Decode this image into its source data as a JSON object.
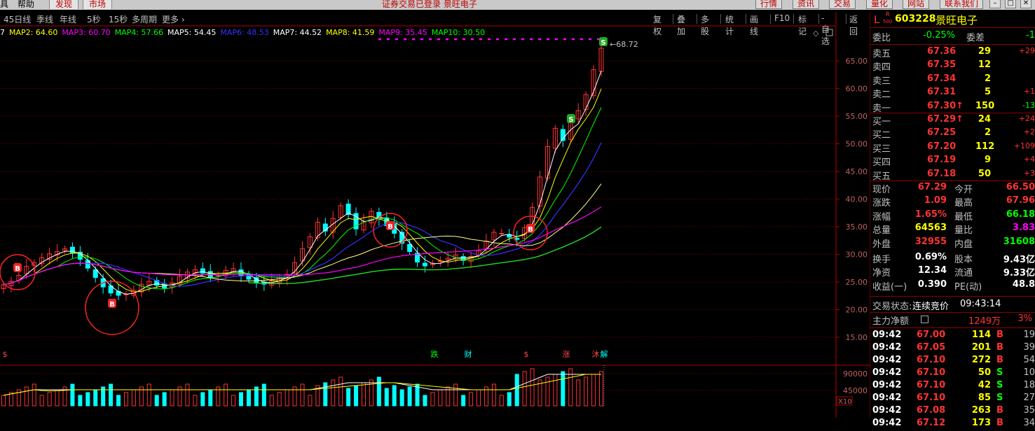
{
  "topbar": {
    "menu_items": [
      "具",
      "帮助"
    ],
    "tabs": [
      "发现",
      "市场"
    ],
    "status": "证券交易已登录  景旺电子",
    "right_buttons": [
      "行情",
      "资讯",
      "交易",
      "量化",
      "网站",
      "联系我们"
    ]
  },
  "periodbar": {
    "periods": [
      "45日线",
      "季线",
      "年线",
      "5秒",
      "15秒",
      "多周期",
      "更多 ›"
    ],
    "tools": [
      "复权",
      "叠加",
      "多股",
      "统计",
      "画线",
      "F10",
      "标记",
      "-自选",
      "返回"
    ]
  },
  "ma_legend": [
    {
      "label": "7",
      "value": "",
      "color": "#ffffff"
    },
    {
      "label": "MAP2:",
      "value": "64.60",
      "color": "#ffff00"
    },
    {
      "label": "MAP3:",
      "value": "60.70",
      "color": "#ff00ff"
    },
    {
      "label": "MAP4:",
      "value": "57.66",
      "color": "#00ff00"
    },
    {
      "label": "MAP5:",
      "value": "54.45",
      "color": "#ffffff"
    },
    {
      "label": "MAP6:",
      "value": "48.53",
      "color": "#3333ff"
    },
    {
      "label": "MAP7:",
      "value": "44.52",
      "color": "#ffffff"
    },
    {
      "label": "MAP8:",
      "value": "41.59",
      "color": "#ffff00"
    },
    {
      "label": "MAP9:",
      "value": "35.45",
      "color": "#ff00ff"
    },
    {
      "label": "MAP10:",
      "value": "30.50",
      "color": "#00ff00"
    }
  ],
  "chart_data": {
    "type": "candlestick",
    "y_ticks": [
      "65.00",
      "60.00",
      "55.00",
      "50.00",
      "45.00",
      "40.00",
      "35.00",
      "30.00",
      "25.00",
      "20.00",
      "15.00"
    ],
    "y_range": [
      15,
      68.72
    ],
    "high_label": "68.72",
    "volume_ticks": [
      "90000",
      "45000"
    ],
    "volume_unit": "X10",
    "event_markers": [
      "$",
      "跌",
      "财",
      "$",
      "涨",
      "沐",
      "解"
    ],
    "signals": [
      "B",
      "B",
      "B",
      "B",
      "S",
      "S"
    ],
    "closes": [
      24.5,
      25.1,
      26.2,
      27.8,
      28.5,
      29.4,
      30.1,
      30.5,
      31.0,
      30.2,
      29.1,
      27.5,
      25.8,
      24.1,
      23.0,
      22.6,
      22.8,
      23.5,
      24.6,
      25.1,
      24.4,
      23.9,
      24.8,
      26.0,
      26.8,
      27.2,
      26.6,
      25.9,
      26.3,
      27.1,
      27.4,
      26.2,
      25.5,
      24.8,
      24.6,
      25.2,
      25.8,
      26.4,
      28.5,
      31.0,
      33.2,
      35.8,
      34.2,
      36.5,
      38.8,
      37.2,
      34.6,
      36.0,
      37.8,
      36.4,
      35.2,
      33.8,
      32.0,
      30.5,
      28.6,
      27.9,
      28.4,
      28.8,
      29.3,
      29.9,
      28.9,
      29.6,
      30.7,
      32.4,
      34.0,
      33.8,
      33.1,
      32.7,
      34.8,
      38.5,
      44.0,
      49.5,
      52.8,
      50.6,
      54.2,
      56.0,
      58.9,
      63.4,
      67.29
    ]
  },
  "quote": {
    "code_prefix": "L",
    "code_tag_top": "R",
    "code_tag_bottom": "500",
    "code": "603228",
    "name": "景旺电子",
    "weibi_label": "委比",
    "weibi": "-0.25%",
    "weicha_label": "委差",
    "weicha": "-1",
    "asks": [
      {
        "label": "卖五",
        "price": "67.36",
        "vol": "29",
        "chg": "+29"
      },
      {
        "label": "卖四",
        "price": "67.35",
        "vol": "12",
        "chg": ""
      },
      {
        "label": "卖三",
        "price": "67.34",
        "vol": "2",
        "chg": ""
      },
      {
        "label": "卖二",
        "price": "67.31",
        "vol": "5",
        "chg": "+1"
      },
      {
        "label": "卖一",
        "price": "67.30↑",
        "vol": "150",
        "chg": "-13"
      }
    ],
    "bids": [
      {
        "label": "买一",
        "price": "67.29↑",
        "vol": "24",
        "chg": "+24"
      },
      {
        "label": "买二",
        "price": "67.25",
        "vol": "2",
        "chg": "+2"
      },
      {
        "label": "买三",
        "price": "67.20",
        "vol": "112",
        "chg": "+109"
      },
      {
        "label": "买四",
        "price": "67.19",
        "vol": "9",
        "chg": "+4"
      },
      {
        "label": "买五",
        "price": "67.18",
        "vol": "50",
        "chg": "+3"
      }
    ],
    "stats": [
      {
        "l1": "现价",
        "v1": "67.29",
        "c1": "#ff3333",
        "l2": "今开",
        "v2": "66.50",
        "c2": "#ff3333"
      },
      {
        "l1": "涨跌",
        "v1": "1.09",
        "c1": "#ff3333",
        "l2": "最高",
        "v2": "67.96",
        "c2": "#ff3333"
      },
      {
        "l1": "涨幅",
        "v1": "1.65%",
        "c1": "#ff3333",
        "l2": "最低",
        "v2": "66.18",
        "c2": "#00ff00"
      },
      {
        "l1": "总量",
        "v1": "64563",
        "c1": "#ffff00",
        "l2": "量比",
        "v2": "3.83",
        "c2": "#ff00ff"
      },
      {
        "l1": "外盘",
        "v1": "32955",
        "c1": "#ff3333",
        "l2": "内盘",
        "v2": "31608",
        "c2": "#00ff00"
      },
      {
        "l1": "换手",
        "v1": "0.69%",
        "c1": "#ffffff",
        "l2": "股本",
        "v2": "9.43亿",
        "c2": "#ffffff"
      },
      {
        "l1": "净资",
        "v1": "12.34",
        "c1": "#ffffff",
        "l2": "流通",
        "v2": "9.33亿",
        "c2": "#ffffff"
      },
      {
        "l1": "收益(一)",
        "v1": "0.390",
        "c1": "#ffffff",
        "l2": "PE(动)",
        "v2": "48.8",
        "c2": "#ffffff"
      }
    ],
    "trade_status_label": "交易状态:",
    "trade_status": "连续竞价",
    "trade_time": "09:43:14",
    "netflow_label": "主力净额",
    "netflow_value": "1249万",
    "netflow_pct": "3%",
    "ticks": [
      {
        "time": "09:42",
        "price": "67.00",
        "vol": "114",
        "side": "B",
        "n": "19"
      },
      {
        "time": "09:42",
        "price": "67.05",
        "vol": "201",
        "side": "B",
        "n": "39"
      },
      {
        "time": "09:42",
        "price": "67.10",
        "vol": "272",
        "side": "B",
        "n": "54"
      },
      {
        "time": "09:42",
        "price": "67.10",
        "vol": "50",
        "side": "S",
        "n": "10"
      },
      {
        "time": "09:42",
        "price": "67.10",
        "vol": "42",
        "side": "S",
        "n": "18"
      },
      {
        "time": "09:42",
        "price": "67.10",
        "vol": "85",
        "side": "S",
        "n": "27"
      },
      {
        "time": "09:42",
        "price": "67.08",
        "vol": "263",
        "side": "B",
        "n": "35"
      },
      {
        "time": "09:42",
        "price": "67.12",
        "vol": "173",
        "side": "B",
        "n": "34"
      }
    ]
  },
  "colors": {
    "up": "#ff3333",
    "down": "#00ffff",
    "grid": "#8b0000",
    "axis": "#b00000"
  }
}
